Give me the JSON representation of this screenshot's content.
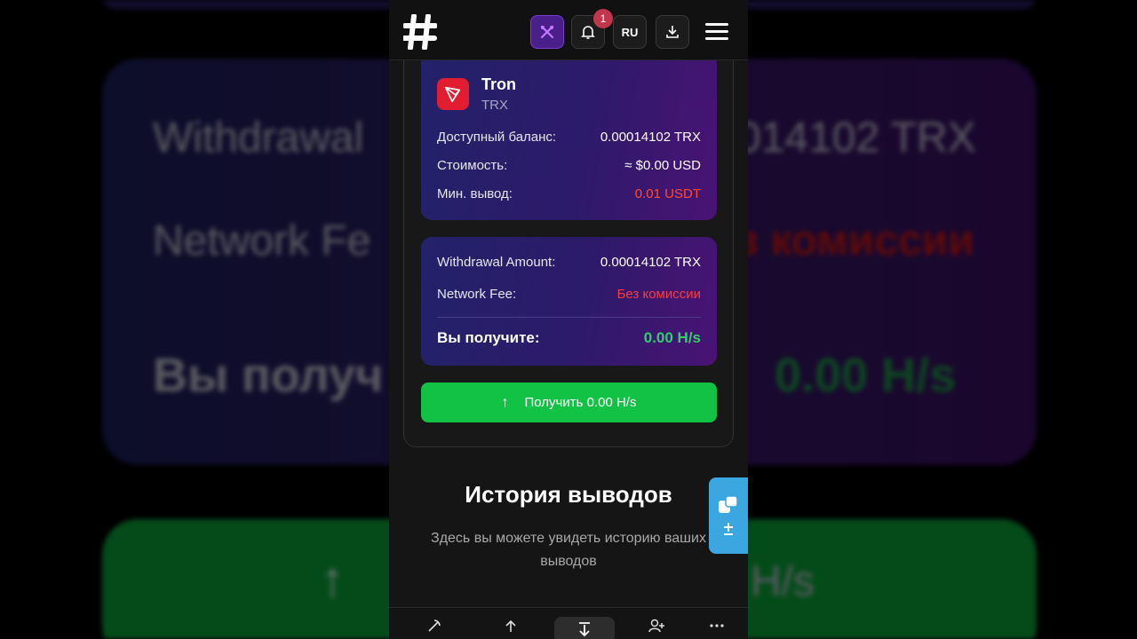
{
  "header": {
    "language": "RU",
    "notification_count": "1"
  },
  "coin": {
    "name": "Tron",
    "ticker": "TRX",
    "rows": [
      {
        "label": "Доступный баланс:",
        "value": "0.00014102 TRX"
      },
      {
        "label": "Стоимость:",
        "value": "≈ $0.00 USD"
      },
      {
        "label": "Мин. вывод:",
        "value": "0.01 USDT"
      }
    ]
  },
  "summary": {
    "withdrawal_label": "Withdrawal Amount:",
    "withdrawal_value": "0.00014102 TRX",
    "fee_label": "Network Fee:",
    "fee_value": "Без комиссии",
    "receive_label": "Вы получите:",
    "receive_value": "0.00 H/s"
  },
  "action": {
    "get_label": "Получить 0.00 H/s"
  },
  "history": {
    "title": "История выводов",
    "subtitle": "Здесь вы можете увидеть историю ваших выводов"
  },
  "background": {
    "withdrawal_text": "Withdrawal",
    "amount_text": "014102 TRX",
    "fee_text": "Network Fe",
    "fee_value_text": "з комиссии",
    "receive_text": "Вы получ",
    "receive_value_text": "0.00 H/s",
    "button_text": "H/s"
  },
  "colors": {
    "accent_green": "#12c244",
    "fee_red": "#ff3b3b",
    "min_orange": "#ff4c2e",
    "receive_green": "#2fd06a",
    "tron_red": "#e11d2f",
    "side_tab_blue": "#3aa7e0"
  },
  "icons": {
    "nav": [
      "pickaxe-icon",
      "upload-icon",
      "download-icon",
      "add-user-icon",
      "more-icon"
    ]
  }
}
